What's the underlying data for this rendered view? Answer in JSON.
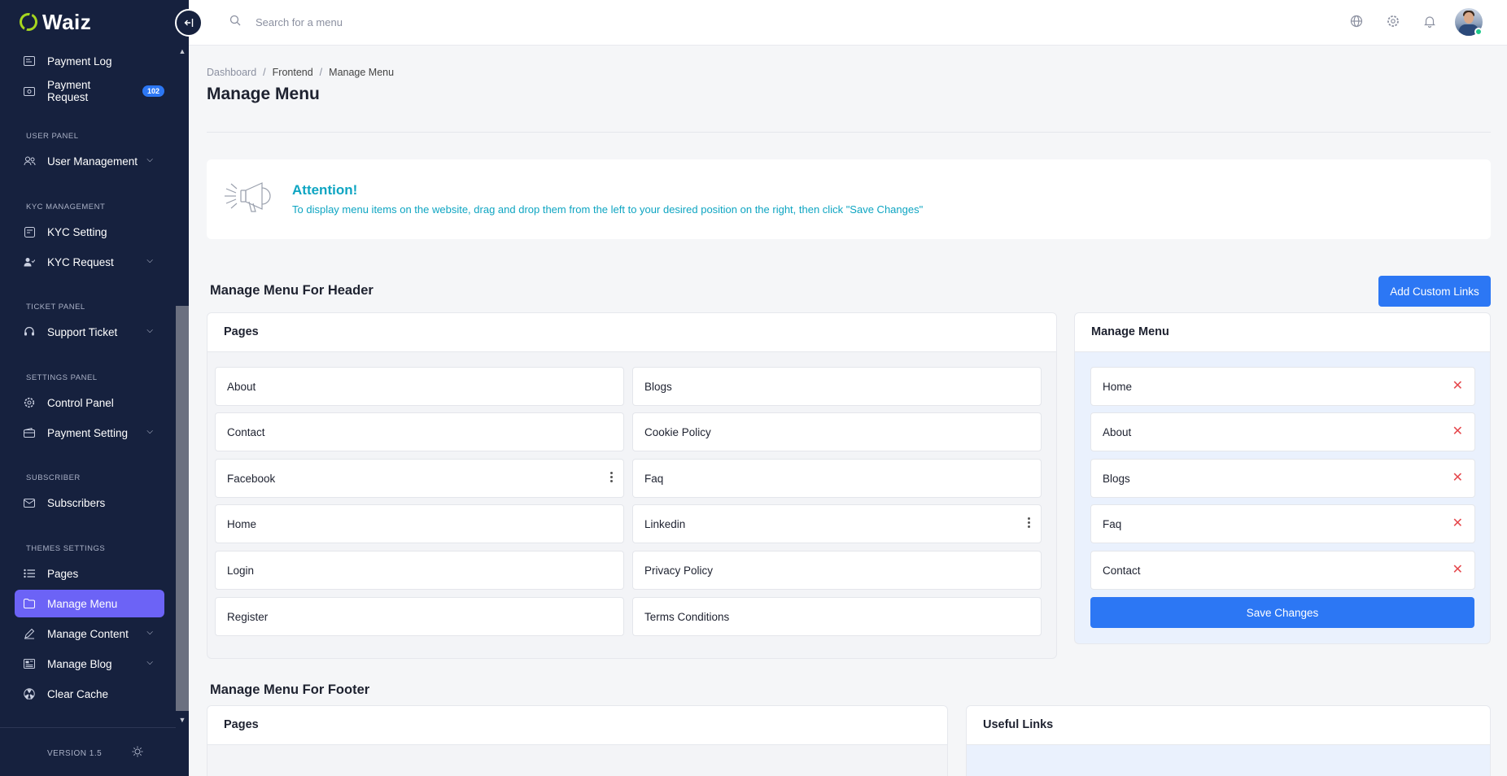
{
  "brand": {
    "name": "Waiz"
  },
  "sidebar": {
    "items": [
      {
        "id": "payment-log",
        "label": "Payment Log",
        "icon": "receipt-icon"
      },
      {
        "id": "payment-request",
        "label": "Payment Request",
        "icon": "cash-icon",
        "badge": "102"
      },
      {
        "id": "user-management",
        "label": "User Management",
        "icon": "users-icon"
      },
      {
        "id": "kyc-setting",
        "label": "KYC Setting",
        "icon": "id-card-icon"
      },
      {
        "id": "kyc-request",
        "label": "KYC Request",
        "icon": "user-check-icon"
      },
      {
        "id": "support-ticket",
        "label": "Support Ticket",
        "icon": "headset-icon"
      },
      {
        "id": "control-panel",
        "label": "Control Panel",
        "icon": "gear-icon"
      },
      {
        "id": "payment-setting",
        "label": "Payment Setting",
        "icon": "wallet-icon"
      },
      {
        "id": "subscribers",
        "label": "Subscribers",
        "icon": "mail-icon"
      },
      {
        "id": "pages",
        "label": "Pages",
        "icon": "list-icon"
      },
      {
        "id": "manage-menu",
        "label": "Manage Menu",
        "icon": "folder-icon",
        "active": true
      },
      {
        "id": "manage-content",
        "label": "Manage Content",
        "icon": "pencil-icon"
      },
      {
        "id": "manage-blog",
        "label": "Manage Blog",
        "icon": "newspaper-icon"
      },
      {
        "id": "clear-cache",
        "label": "Clear Cache",
        "icon": "radiation-icon"
      }
    ],
    "headings": {
      "user_panel": "USER PANEL",
      "kyc": "KYC MANAGEMENT",
      "ticket": "TICKET PANEL",
      "settings": "SETTINGS PANEL",
      "subscriber": "SUBSCRIBER",
      "themes": "THEMES SETTINGS"
    },
    "version": "VERSION 1.5"
  },
  "topbar": {
    "search_placeholder": "Search for a menu"
  },
  "breadcrumb": {
    "items": [
      "Dashboard",
      "Frontend",
      "Manage Menu"
    ]
  },
  "page_title": "Manage Menu",
  "attention": {
    "title": "Attention!",
    "text": "To display menu items on the website, drag and drop them from the left to your desired position on the right, then click \"Save Changes\""
  },
  "header_section": {
    "title": "Manage Menu For Header",
    "add_button": "Add Custom Links",
    "pages_card_title": "Pages",
    "pages": [
      "About",
      "Blogs",
      "Contact",
      "Cookie Policy",
      "Facebook",
      "Faq",
      "Home",
      "Linkedin",
      "Login",
      "Privacy Policy",
      "Register",
      "Terms Conditions"
    ],
    "menu_card_title": "Manage Menu",
    "menu_items": [
      "Home",
      "About",
      "Blogs",
      "Faq",
      "Contact"
    ],
    "save_button": "Save Changes"
  },
  "footer_section": {
    "title": "Manage Menu For Footer",
    "pages_card_title": "Pages",
    "links_card_title": "Useful Links"
  }
}
